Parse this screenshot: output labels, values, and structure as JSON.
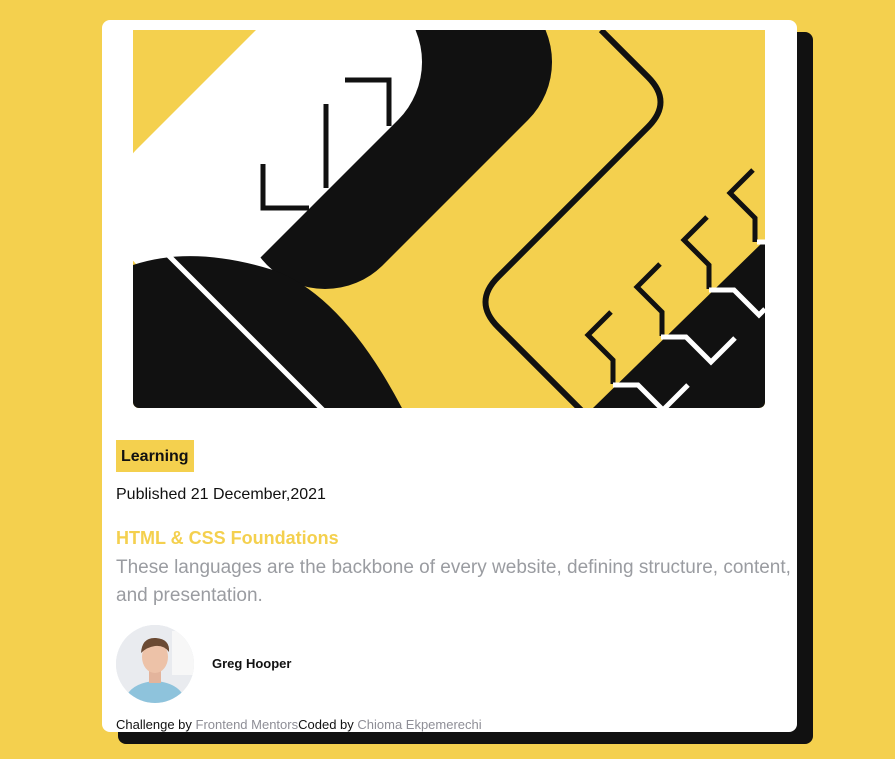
{
  "card": {
    "tag": "Learning",
    "published": "Published 21 December,2021",
    "title": "HTML & CSS Foundations",
    "description": "These languages are the backbone of every website, defining structure, content, and presentation.",
    "author": {
      "name": "Greg Hooper"
    }
  },
  "attribution": {
    "challenge_prefix": "Challenge by ",
    "challenge_link": "Frontend Mentors",
    "coded_prefix": "Coded by ",
    "coded_link": "Chioma Ekpemerechi"
  },
  "colors": {
    "page_background": "#f4d04e",
    "card_background": "#ffffff",
    "shadow": "#111111",
    "accent": "#f4d04e",
    "muted_text": "#9a9ca1"
  },
  "icons": {
    "hero": "abstract-illustration",
    "avatar": "person-photo"
  }
}
